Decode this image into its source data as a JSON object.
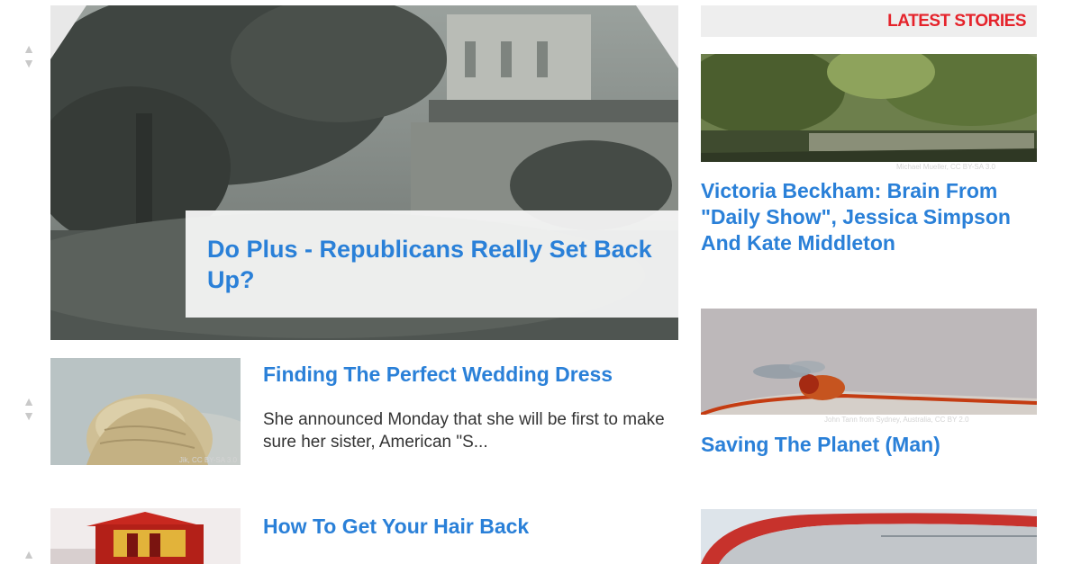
{
  "hero": {
    "title": "Do Plus - Republicans Really Set Back Up?"
  },
  "vote": {
    "up_icon": "▲",
    "down_icon": "▼"
  },
  "feed": [
    {
      "title": "Finding The Perfect Wedding Dress",
      "excerpt": "She announced Monday that she will be first to make sure her sister, American \"S...",
      "credit": "Jik, CC BY-SA 3.0"
    },
    {
      "title": "How To Get Your Hair Back",
      "excerpt": "",
      "credit": ""
    }
  ],
  "sidebar": {
    "header": "LATEST STORIES",
    "stories": [
      {
        "title": "Victoria Beckham: Brain From \"Daily Show\", Jessica Simpson And Kate Middleton",
        "credit": "Michael Mueller, CC BY-SA 3.0"
      },
      {
        "title": "Saving The Planet (Man)",
        "credit": "John Tann from Sydney, Australia, CC BY 2.0"
      },
      {
        "title": "",
        "credit": ""
      }
    ]
  },
  "colors": {
    "link": "#2a80d8",
    "accent": "#e5232b",
    "header_bg": "#eeeeee"
  }
}
